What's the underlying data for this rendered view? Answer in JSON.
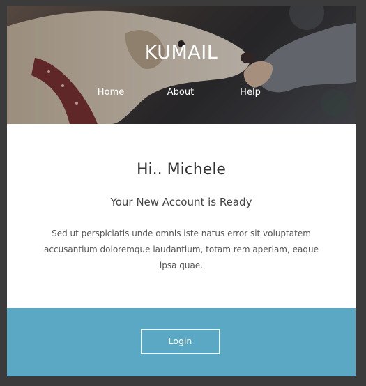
{
  "brand": {
    "name": "KUMAIL"
  },
  "nav": {
    "items": [
      "Home",
      "About",
      "Help"
    ]
  },
  "content": {
    "greeting": "Hi.. Michele",
    "subtitle": "Your New Account is Ready",
    "body": "Sed ut perspiciatis unde omnis iste natus error sit voluptatem accusantium doloremque laudantium, totam rem aperiam, eaque ipsa quae."
  },
  "footer": {
    "login_label": "Login"
  },
  "colors": {
    "accent": "#5aa8c4",
    "page_bg": "#3b3b3b",
    "card_bg": "#ffffff"
  }
}
